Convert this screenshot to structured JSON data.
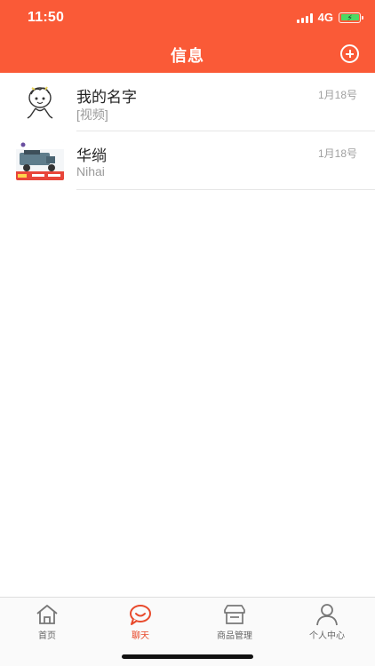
{
  "status_bar": {
    "time": "11:50",
    "network": "4G"
  },
  "header": {
    "title": "信息",
    "add_icon": "plus-circle-icon"
  },
  "conversations": [
    {
      "name": "我的名字",
      "preview": "[视频]",
      "date": "1月18号"
    },
    {
      "name": "华绱",
      "preview": "Nihai",
      "date": "1月18号"
    }
  ],
  "tabs": [
    {
      "label": "首页",
      "icon": "home-icon",
      "active": false
    },
    {
      "label": "聊天",
      "icon": "chat-icon",
      "active": true
    },
    {
      "label": "商品管理",
      "icon": "store-icon",
      "active": false
    },
    {
      "label": "个人中心",
      "icon": "user-icon",
      "active": false
    }
  ],
  "colors": {
    "accent": "#fa5a37",
    "active_tab": "#e84a2c",
    "inactive_tab": "#666666",
    "battery_fill": "#4cd964"
  }
}
